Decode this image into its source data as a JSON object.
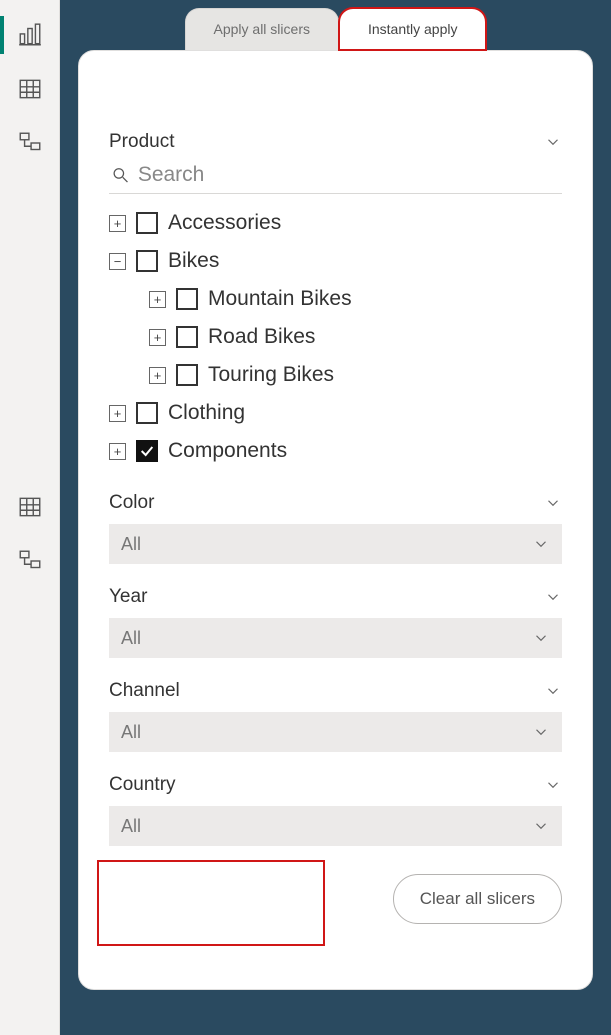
{
  "tabs": {
    "apply_all": "Apply all slicers",
    "instantly": "Instantly apply"
  },
  "slicers": {
    "product": {
      "title": "Product",
      "search_placeholder": "Search",
      "tree": [
        {
          "label": "Accessories",
          "expander": "+",
          "checked": false,
          "indent": 0
        },
        {
          "label": "Bikes",
          "expander": "−",
          "checked": false,
          "indent": 0
        },
        {
          "label": "Mountain Bikes",
          "expander": "+",
          "checked": false,
          "indent": 1
        },
        {
          "label": "Road Bikes",
          "expander": "+",
          "checked": false,
          "indent": 1
        },
        {
          "label": "Touring Bikes",
          "expander": "+",
          "checked": false,
          "indent": 1
        },
        {
          "label": "Clothing",
          "expander": "+",
          "checked": false,
          "indent": 0
        },
        {
          "label": "Components",
          "expander": "+",
          "checked": true,
          "indent": 0
        }
      ]
    },
    "color": {
      "title": "Color",
      "value": "All"
    },
    "year": {
      "title": "Year",
      "value": "All"
    },
    "channel": {
      "title": "Channel",
      "value": "All"
    },
    "country": {
      "title": "Country",
      "value": "All"
    }
  },
  "buttons": {
    "clear_all": "Clear all slicers"
  }
}
